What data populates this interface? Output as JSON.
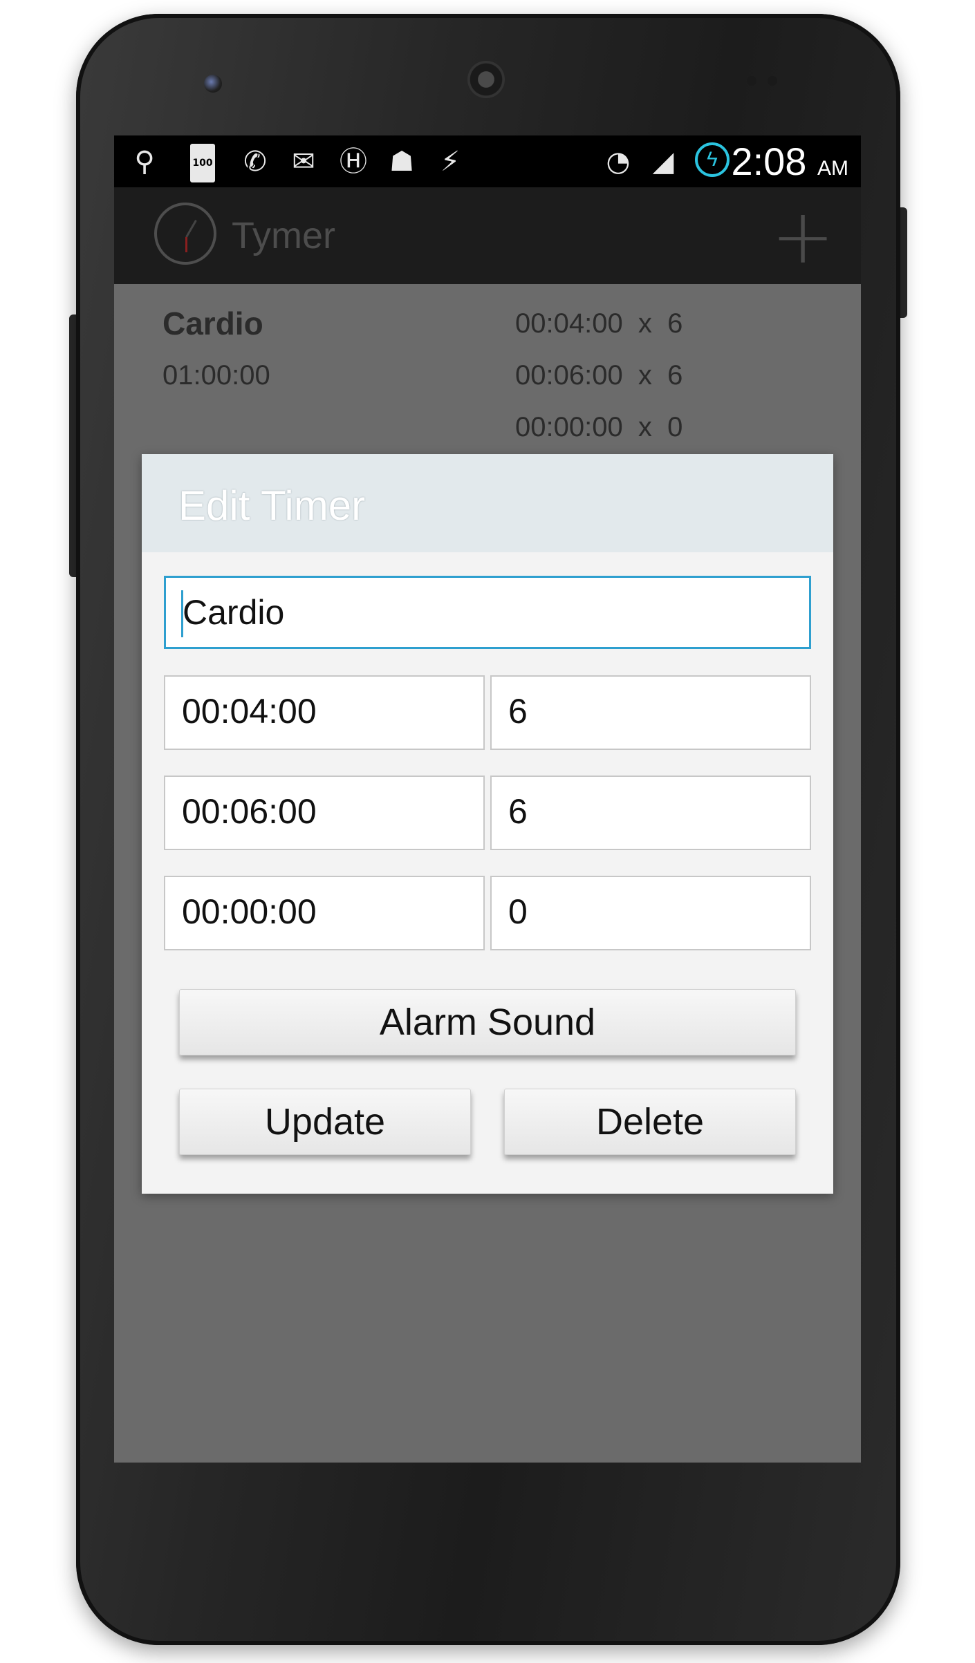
{
  "status_bar": {
    "icons": [
      "usb-icon",
      "battery-100-icon",
      "call-forward-icon",
      "email-icon",
      "h-icon",
      "android-debug-icon",
      "flash-icon",
      "wifi-icon",
      "signal-icon",
      "charging-icon"
    ],
    "battery_label": "100",
    "time": "2:08",
    "ampm": "AM"
  },
  "action_bar": {
    "title": "Tymer",
    "add_symbol": "+"
  },
  "timer_list": [
    {
      "name": "Cardio",
      "total": "01:00:00",
      "intervals": [
        "00:04:00  x  6",
        "00:06:00  x  6",
        "00:00:00  x  0"
      ]
    }
  ],
  "dialog": {
    "title": "Edit Timer",
    "name_value": "Cardio",
    "rows": [
      {
        "time": "00:04:00",
        "count": "6"
      },
      {
        "time": "00:06:00",
        "count": "6"
      },
      {
        "time": "00:00:00",
        "count": "0"
      }
    ],
    "alarm_button": "Alarm Sound",
    "update_button": "Update",
    "delete_button": "Delete"
  },
  "colors": {
    "accent": "#2e9fcf",
    "dim_overlay": "#6b6b6b",
    "action_bar": "#1c1c1c",
    "dialog_header": "#e2e9ec"
  }
}
